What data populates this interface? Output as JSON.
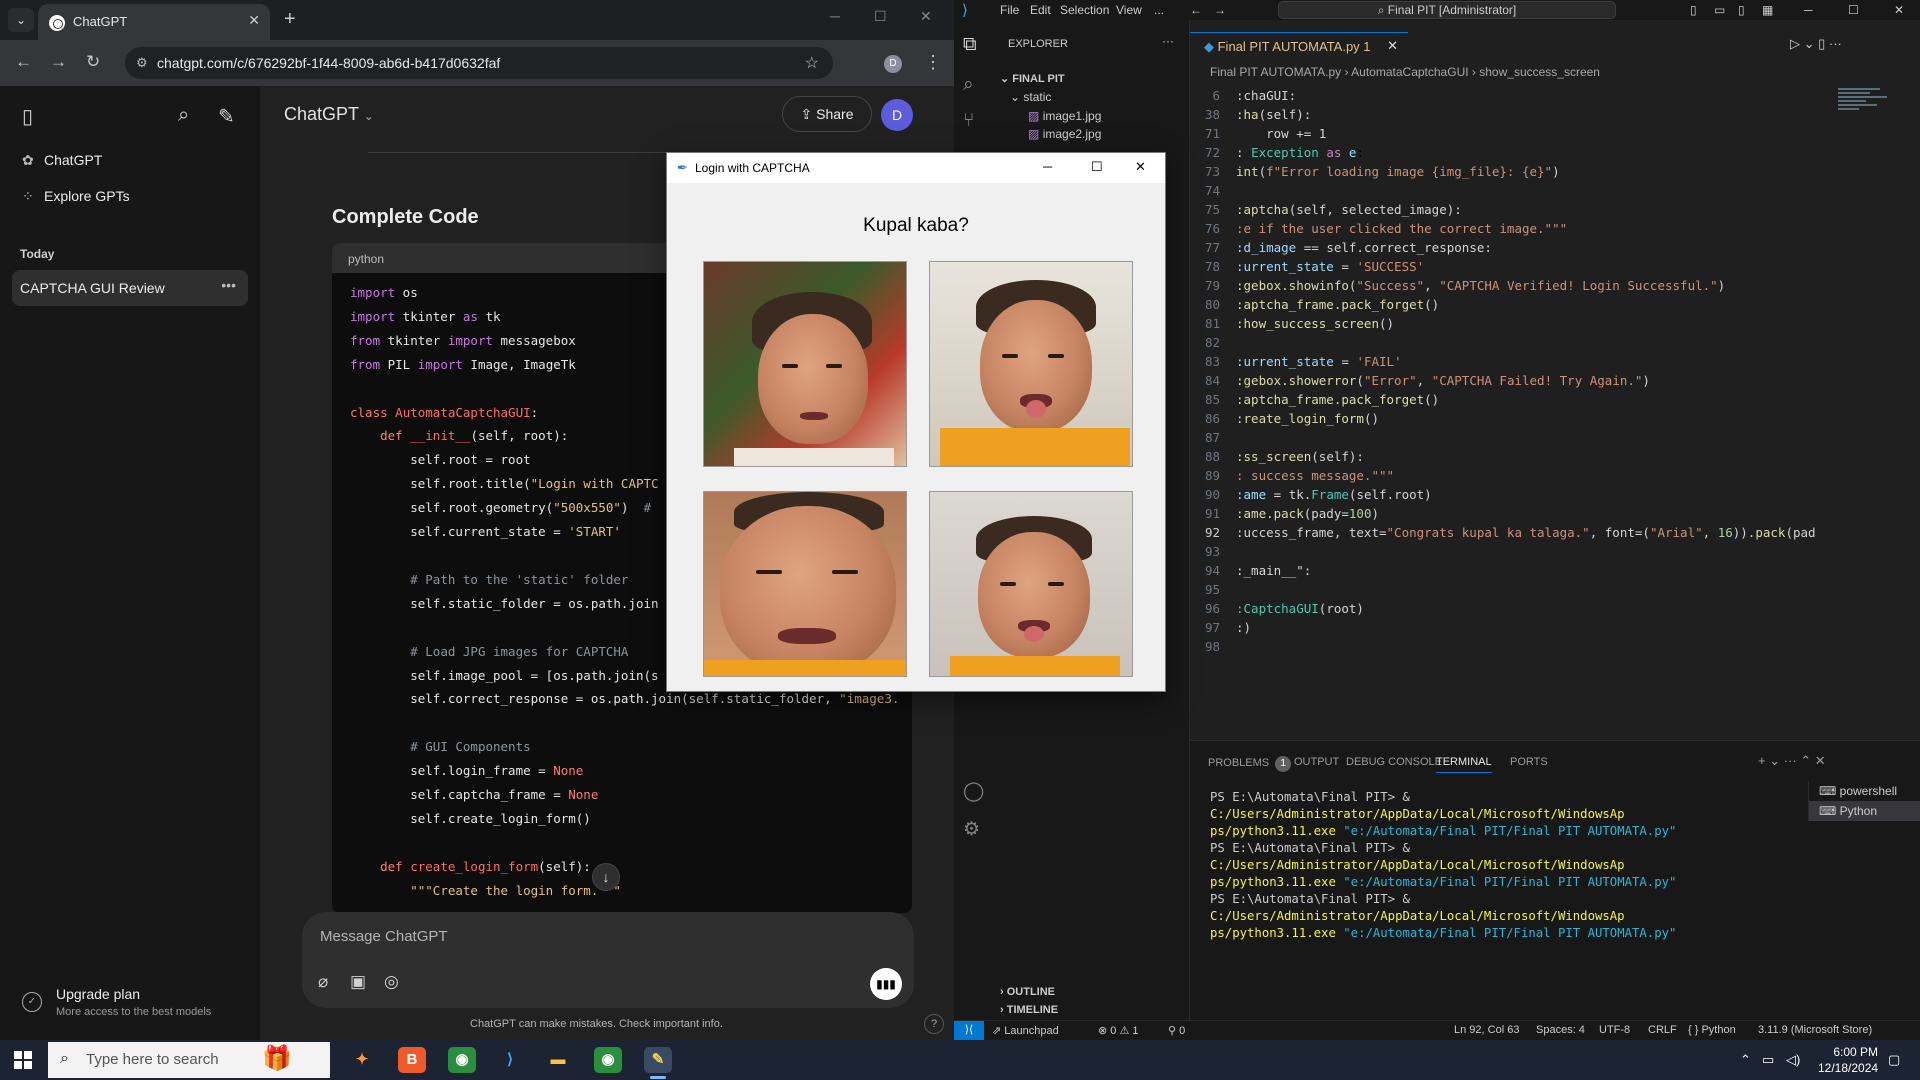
{
  "browser": {
    "tab_title": "ChatGPT",
    "url": "chatgpt.com/c/676292bf-1f44-8009-ab6d-b417d0632faf",
    "profile_initial": "D"
  },
  "chatgpt": {
    "sidebar": {
      "items": [
        {
          "label": "ChatGPT",
          "icon": "openai-logo-icon"
        },
        {
          "label": "Explore GPTs",
          "icon": "grid-icon"
        }
      ],
      "section_today": "Today",
      "conversation": "CAPTCHA GUI Review",
      "upgrade_title": "Upgrade plan",
      "upgrade_sub": "More access to the best models"
    },
    "model_label": "ChatGPT",
    "share_label": "Share",
    "avatar_initial": "D",
    "heading": "Complete Code",
    "code_lang": "python",
    "composer_placeholder": "Message ChatGPT",
    "disclaimer": "ChatGPT can make mistakes. Check important info.",
    "help": "?"
  },
  "captcha_window": {
    "title": "Login with CAPTCHA",
    "question": "Kupal kaba?"
  },
  "vscode": {
    "menu": [
      "File",
      "Edit",
      "Selection",
      "View",
      "..."
    ],
    "command_center": "Final PIT [Administrator]",
    "explorer": {
      "header": "EXPLORER",
      "root": "FINAL PIT",
      "folder": "static",
      "files": [
        "image1.jpg",
        "image2.jpg"
      ],
      "outline": "OUTLINE",
      "timeline": "TIMELINE"
    },
    "editor_tab": "Final PIT AUTOMATA.py 1",
    "breadcrumbs": [
      "Final PIT AUTOMATA.py",
      "AutomataCaptchaGUI",
      "show_success_screen"
    ],
    "panel_tabs": [
      "PROBLEMS",
      "OUTPUT",
      "DEBUG CONSOLE",
      "TERMINAL",
      "PORTS"
    ],
    "problems_count": "1",
    "terminal_list": [
      "powershell",
      "Python"
    ],
    "terminal": [
      {
        "prompt": "PS E:\\Automata\\Final PIT> & ",
        "cmd": "C:/Users/Administrator/AppData/Local/Microsoft/WindowsAp",
        "cont": "ps/python3.11.exe",
        "arg": "\"e:/Automata/Final PIT/Final PIT AUTOMATA.py\""
      },
      {
        "prompt": "PS E:\\Automata\\Final PIT> & ",
        "cmd": "C:/Users/Administrator/AppData/Local/Microsoft/WindowsAp",
        "cont": "ps/python3.11.exe",
        "arg": "\"e:/Automata/Final PIT/Final PIT AUTOMATA.py\""
      },
      {
        "prompt": "PS E:\\Automata\\Final PIT> & ",
        "cmd": "C:/Users/Administrator/AppData/Local/Microsoft/WindowsAp",
        "cont": "ps/python3.11.exe",
        "arg": "\"e:/Automata/Final PIT/Final PIT AUTOMATA.py\""
      }
    ],
    "status": {
      "launchpad": "Launchpad",
      "errors": "⊗ 0 ⚠ 1",
      "ports": "⚲ 0",
      "position": "Ln 92, Col 63",
      "spaces": "Spaces: 4",
      "encoding": "UTF-8",
      "eol": "CRLF",
      "language": "{ } Python",
      "interpreter": "3.11.9 (Microsoft Store)"
    }
  },
  "taskbar": {
    "search_placeholder": "Type here to search",
    "time": "6:00 PM",
    "date": "12/18/2024"
  }
}
